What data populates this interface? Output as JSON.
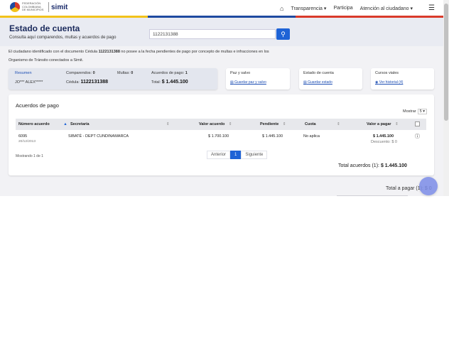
{
  "header": {
    "logo_lines": [
      "FEDERACIÓN",
      "COLOMBIANA",
      "DE MUNICIPIOS"
    ],
    "brand": "simit",
    "nav": {
      "transparencia": "Transparencia",
      "participa": "Participa",
      "atencion": "Atención al ciudadano"
    },
    "stripe_colors": [
      "#f2c21b",
      "#1f4aa0",
      "#d93a2b"
    ]
  },
  "page": {
    "title": "Estado de cuenta",
    "subtitle": "Consulta aquí comparendos, multas y acuerdos de pago",
    "search_value": "1122131388"
  },
  "info": {
    "line1_a": "El ciudadano identificado con el documento Cédula",
    "doc": "1122131388",
    "line1_b": "no posee a la fecha pendientes de pago por concepto de multas e infracciones en los",
    "line2": "Organismo de Tránsito conectados a Simit."
  },
  "resumen": {
    "label": "Resumen",
    "name": "JO*** ALEX*****",
    "comparendos_label": "Comparendos:",
    "comparendos": "0",
    "multas_label": "Multas:",
    "multas": "0",
    "acuerdos_label": "Acuerdos de pago:",
    "acuerdos": "1",
    "cedula_label": "Cédula:",
    "cedula": "1122131388",
    "total_label": "Total:",
    "total": "$ 1.445.100"
  },
  "cards": [
    {
      "title": "Paz y salvo",
      "link": "Guardar paz y salvo"
    },
    {
      "title": "Estado de cuenta",
      "link": "Guardar estado"
    },
    {
      "title": "Cursos viales",
      "link": "Ver historial (4)"
    }
  ],
  "acuerdos": {
    "title": "Acuerdos de pago",
    "mostrar_label": "Mostrar",
    "mostrar_value": "5",
    "columns": [
      "Número acuerdo",
      "Secretaría",
      "Valor acuerdo",
      "Pendiente",
      "Cuota",
      "Valor a pagar"
    ],
    "row": {
      "numero": "6095",
      "fecha": "20/12/2013",
      "secretaria": "SIBATÉ - DEPT CUNDINAMARCA",
      "valor_acuerdo": "$ 1.700.100",
      "pendiente": "$ 1.445.100",
      "cuota": "No aplica",
      "valor_pagar": "$ 1.445.100",
      "descuento": "Descuento: $ 0"
    },
    "mostrando": "Mostrando 1 de 1",
    "pager": {
      "anterior": "Anterior",
      "page": "1",
      "siguiente": "Siguiente"
    },
    "total_acuerdos_label": "Total acuerdos (1):",
    "total_acuerdos": "$ 1.445.100"
  },
  "footer": {
    "total_pagar_label": "Total a pagar (1):",
    "total_pagar_value": "$ 0"
  },
  "icons": [
    "home-icon",
    "caret-down-icon",
    "hamburger-icon",
    "search-icon",
    "document-icon",
    "sort-icon",
    "info-icon",
    "chat-icon"
  ]
}
